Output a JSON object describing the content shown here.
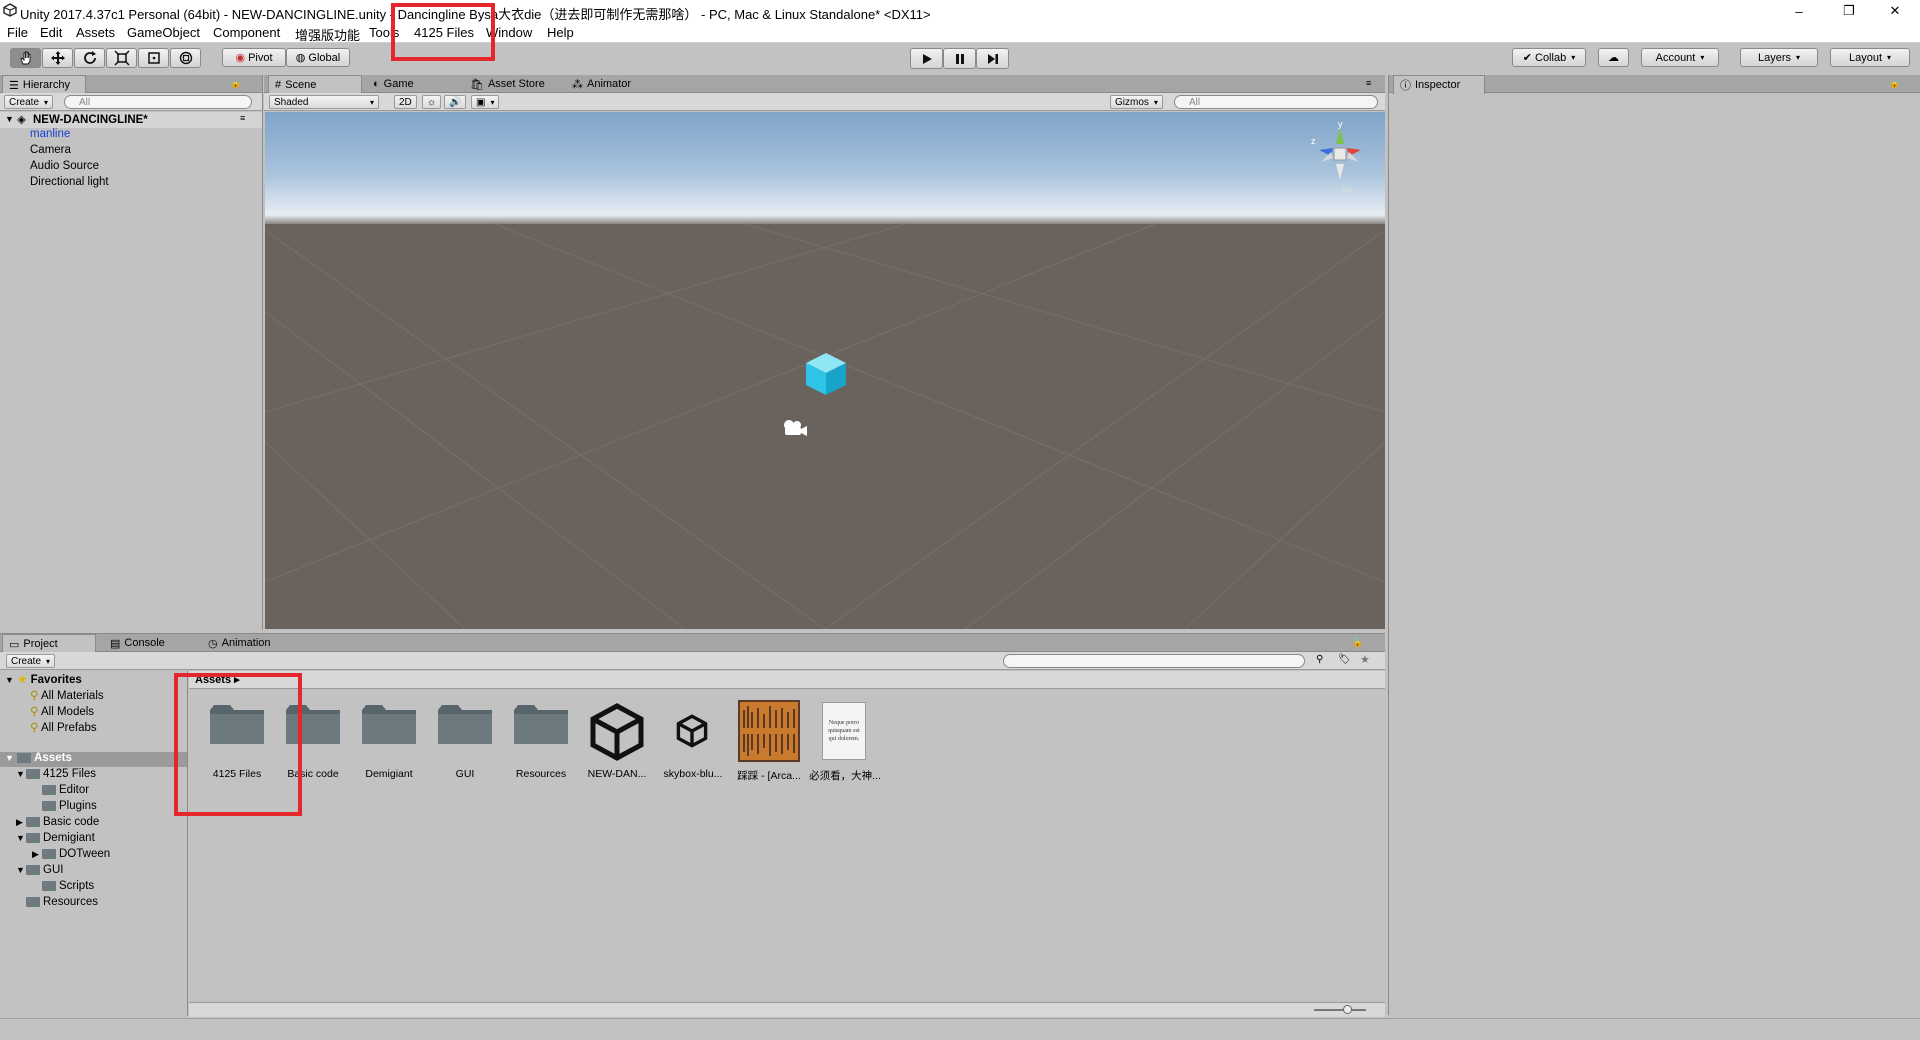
{
  "window": {
    "title": "Unity 2017.4.37c1 Personal (64bit) - NEW-DANCINGLINE.unity - Dancingline Bysa大衣die（进去即可制作无需那啥） - PC, Mac & Linux Standalone* <DX11>",
    "minimize": "–",
    "restore": "❐",
    "close": "✕"
  },
  "menu": [
    "File",
    "Edit",
    "Assets",
    "GameObject",
    "Component",
    "增强版功能",
    "Tools",
    "4125 Files",
    "Window",
    "Help"
  ],
  "toolbar": {
    "pivot": "Pivot",
    "global": "Global",
    "collab": "Collab",
    "account": "Account",
    "layers": "Layers",
    "layout": "Layout"
  },
  "hierarchy": {
    "tab": "Hierarchy",
    "create": "Create",
    "search_placeholder": "All",
    "scene": "NEW-DANCINGLINE*",
    "items": [
      "manline",
      "Camera",
      "Audio Source",
      "Directional light"
    ]
  },
  "scene_tabs": [
    "Scene",
    "Game",
    "Asset Store",
    "Animator"
  ],
  "scene_bar": {
    "shading": "Shaded",
    "mode_2d": "2D",
    "gizmos": "Gizmos",
    "search_placeholder": "All",
    "axis_y": "y",
    "axis_z": "z",
    "persp": "← Iso"
  },
  "inspector": {
    "tab": "Inspector"
  },
  "bottom_tabs": [
    "Project",
    "Console",
    "Animation"
  ],
  "project": {
    "create": "Create",
    "favorites_label": "Favorites",
    "favorites": [
      "All Materials",
      "All Models",
      "All Prefabs"
    ],
    "assets_label": "Assets",
    "tree": [
      {
        "label": "4125 Files",
        "level": 1,
        "arrow": "▼"
      },
      {
        "label": "Editor",
        "level": 2,
        "arrow": ""
      },
      {
        "label": "Plugins",
        "level": 2,
        "arrow": ""
      },
      {
        "label": "Basic code",
        "level": 1,
        "arrow": "▶"
      },
      {
        "label": "Demigiant",
        "level": 1,
        "arrow": "▼"
      },
      {
        "label": "DOTween",
        "level": 2,
        "arrow": "▶"
      },
      {
        "label": "GUI",
        "level": 1,
        "arrow": "▼"
      },
      {
        "label": "Scripts",
        "level": 2,
        "arrow": ""
      },
      {
        "label": "Resources",
        "level": 1,
        "arrow": ""
      }
    ],
    "breadcrumb": "Assets ▸",
    "assets": [
      {
        "label": "4125 Files",
        "kind": "folder"
      },
      {
        "label": "Basic code",
        "kind": "folder"
      },
      {
        "label": "Demigiant",
        "kind": "folder"
      },
      {
        "label": "GUI",
        "kind": "folder"
      },
      {
        "label": "Resources",
        "kind": "folder"
      },
      {
        "label": "NEW-DAN...",
        "kind": "unity-scene"
      },
      {
        "label": "skybox-blu...",
        "kind": "unity-material"
      },
      {
        "label": "踩踩 - [Arca...",
        "kind": "audio"
      },
      {
        "label": "必须看，大神...",
        "kind": "text"
      }
    ],
    "text_thumb": "Neque porro quisquam est qui dolorem."
  },
  "colors": {
    "highlight": "#e5262d",
    "cube": "#2ec4e6",
    "selected_text": "#1a3fcf"
  }
}
